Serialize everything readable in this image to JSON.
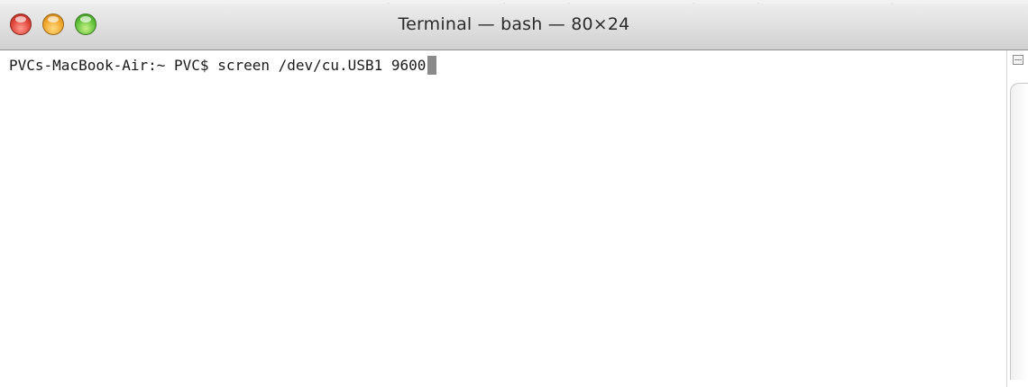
{
  "window": {
    "title": "Terminal — bash — 80×24"
  },
  "traffic_lights": {
    "close_color": "#e0443a",
    "minimize_color": "#f0a72a",
    "zoom_color": "#62c23a"
  },
  "terminal": {
    "prompt": "PVCs-MacBook-Air:~ PVC$ ",
    "command": "screen /dev/cu.USB1 9600"
  },
  "icons": {
    "close": "close-icon",
    "minimize": "minimize-icon",
    "zoom": "zoom-icon",
    "split": "split-pane-icon"
  }
}
